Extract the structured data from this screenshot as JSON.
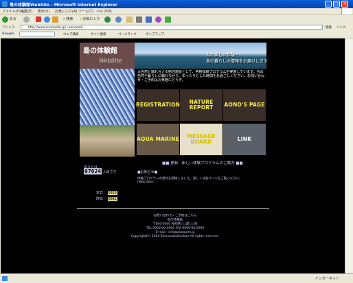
{
  "window": {
    "title": "島の体験館WebSite - Microsoft Internet Explorer"
  },
  "menu": [
    "ファイル(F)",
    "編集(E)",
    "表示(V)",
    "お気に入り(A)",
    "ツール(T)",
    "ヘルプ(H)"
  ],
  "toolbar": {
    "back_label": "戻る",
    "search_label": "検索",
    "favorites_label": "お気に入り"
  },
  "address": {
    "label": "アドレス",
    "url": "http://www.sunmedia.jp/~aonoumi/",
    "go": "移動",
    "links": "リンク"
  },
  "googlebar": {
    "logo": "Google",
    "items": [
      "ウェブ検索",
      "サイト検索",
      "ページランク",
      "ポップアップ"
    ]
  },
  "site": {
    "logo_line1": "島の体験館",
    "logo_line2": "WebSite",
    "banner_line1": "島の楽しい体験・",
    "banner_line2": "島の暮らしの情報をお届けします",
    "intro": "大自然と触れ合える宿泊施設として、各種体験プログラムを実施しています。島の自然や暮らしに触れながら、ゆったりとした時間をお過ごしください。お問い合わせ・ご予約はお気軽にどうぞ。",
    "tiles": [
      "REGISTRATION",
      "NATURE REPORT",
      "AONO'S PAGE",
      "AQUA MARINE",
      "MESSAGE BOARD",
      "LINK"
    ],
    "notice": "■■ 更新：新しい体験プログラムのご案内 ■■",
    "visitor_label": "あなたは",
    "counter": "07024",
    "visitor_suffix": "人目です",
    "small_lines": [
      "本日：",
      "昨日："
    ],
    "today": "0033",
    "yesterday": "0081",
    "news_title": "■お知らせ■",
    "news_text": "体験プログラムの受付を開始しました。詳しくは各ページをご覧ください。(Web Site)",
    "footer_lines": [
      "お問い合わせ・ご予約はこちら",
      "島の体験館",
      "〒000-0000 長崎県○○郡○○町",
      "TEL 0000-00-0000 FAX 0000-00-0000",
      "E-mail：info@aonoumi.jp",
      "Copyright(C) 2004 Shimanotaikenkan All rights reserved."
    ]
  },
  "status": {
    "zone": "インターネット"
  }
}
